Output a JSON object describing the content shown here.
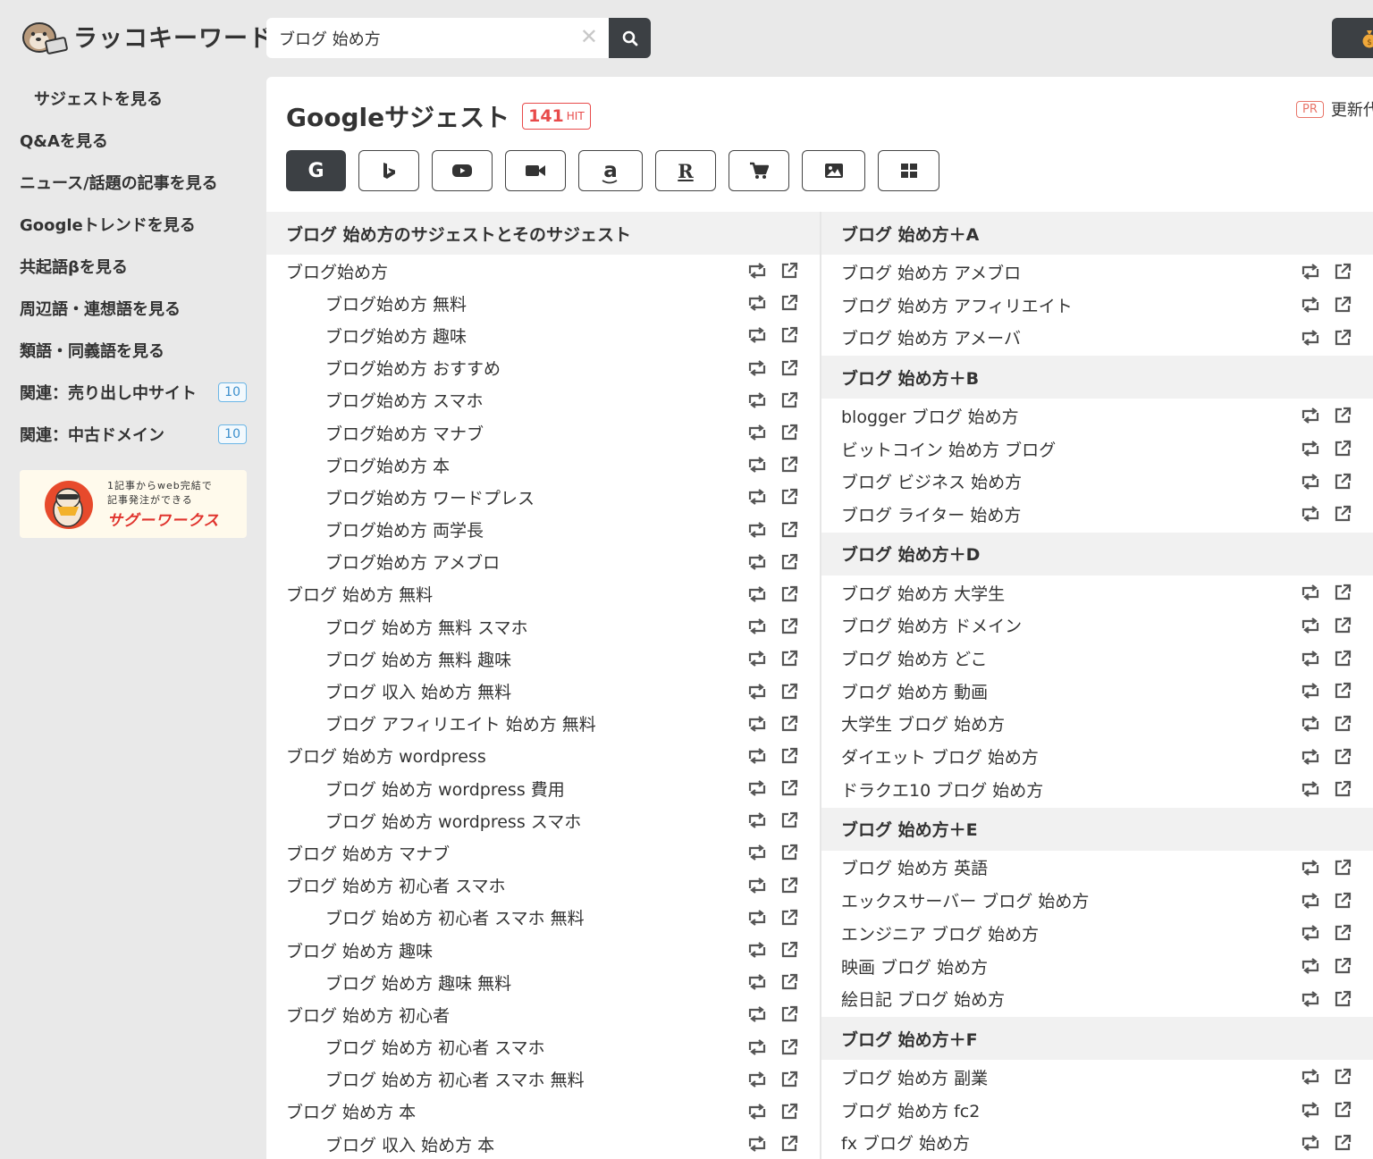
{
  "header": {
    "logo_text": "ラッコキーワード",
    "search_value": "ブログ 始め方",
    "clear_symbol": "✕"
  },
  "sidebar": {
    "items": [
      {
        "label": "サジェストを見る"
      },
      {
        "label": "Q&Aを見る"
      },
      {
        "label": "ニュース/話題の記事を見る"
      },
      {
        "label": "Googleトレンドを見る"
      },
      {
        "label": "共起語βを見る"
      },
      {
        "label": "周辺語・連想語を見る"
      },
      {
        "label": "類語・同義語を見る"
      },
      {
        "label": "関連：売り出し中サイト",
        "count": "10"
      },
      {
        "label": "関連：中古ドメイン",
        "count": "10"
      }
    ],
    "banner": {
      "sub": "1記事からweb完結で\n記事発注ができる",
      "title": "サグーワークス"
    }
  },
  "main": {
    "title": "Googleサジェスト",
    "hit_count": "141",
    "hit_unit": "HIT",
    "pr_badge": "PR",
    "pr_text": "更新代",
    "tabs": [
      {
        "name": "google",
        "icon": "google-icon",
        "label": "G"
      },
      {
        "name": "bing",
        "icon": "bing-icon",
        "label": "b"
      },
      {
        "name": "youtube",
        "icon": "youtube-icon",
        "label": ""
      },
      {
        "name": "video",
        "icon": "video-camera-icon",
        "label": ""
      },
      {
        "name": "amazon",
        "icon": "amazon-icon",
        "label": "a"
      },
      {
        "name": "rakuten",
        "icon": "rakuten-icon",
        "label": "R"
      },
      {
        "name": "shopping",
        "icon": "cart-icon",
        "label": ""
      },
      {
        "name": "image",
        "icon": "image-icon",
        "label": ""
      },
      {
        "name": "apps",
        "icon": "grid-icon",
        "label": ""
      }
    ],
    "left_section": {
      "title": "ブログ 始め方のサジェストとそのサジェスト",
      "rows": [
        {
          "text": "ブログ始め方",
          "indent": 0
        },
        {
          "text": "ブログ始め方 無料",
          "indent": 1
        },
        {
          "text": "ブログ始め方 趣味",
          "indent": 1
        },
        {
          "text": "ブログ始め方 おすすめ",
          "indent": 1
        },
        {
          "text": "ブログ始め方 スマホ",
          "indent": 1
        },
        {
          "text": "ブログ始め方 マナブ",
          "indent": 1
        },
        {
          "text": "ブログ始め方 本",
          "indent": 1
        },
        {
          "text": "ブログ始め方 ワードプレス",
          "indent": 1
        },
        {
          "text": "ブログ始め方 両学長",
          "indent": 1
        },
        {
          "text": "ブログ始め方 アメブロ",
          "indent": 1
        },
        {
          "text": "ブログ 始め方 無料",
          "indent": 0
        },
        {
          "text": "ブログ 始め方 無料 スマホ",
          "indent": 1
        },
        {
          "text": "ブログ 始め方 無料 趣味",
          "indent": 1
        },
        {
          "text": "ブログ 収入 始め方 無料",
          "indent": 1
        },
        {
          "text": "ブログ アフィリエイト 始め方 無料",
          "indent": 1
        },
        {
          "text": "ブログ 始め方 wordpress",
          "indent": 0
        },
        {
          "text": "ブログ 始め方 wordpress 費用",
          "indent": 1
        },
        {
          "text": "ブログ 始め方 wordpress スマホ",
          "indent": 1
        },
        {
          "text": "ブログ 始め方 マナブ",
          "indent": 0
        },
        {
          "text": "ブログ 始め方 初心者 スマホ",
          "indent": 0
        },
        {
          "text": "ブログ 始め方 初心者 スマホ 無料",
          "indent": 1
        },
        {
          "text": "ブログ 始め方 趣味",
          "indent": 0
        },
        {
          "text": "ブログ 始め方 趣味 無料",
          "indent": 1
        },
        {
          "text": "ブログ 始め方 初心者",
          "indent": 0
        },
        {
          "text": "ブログ 始め方 初心者 スマホ",
          "indent": 1
        },
        {
          "text": "ブログ 始め方 初心者 スマホ 無料",
          "indent": 1
        },
        {
          "text": "ブログ 始め方 本",
          "indent": 0
        },
        {
          "text": "ブログ 収入 始め方 本",
          "indent": 1
        }
      ]
    },
    "right_sections": [
      {
        "title": "ブログ 始め方＋A",
        "rows": [
          "ブログ 始め方 アメブロ",
          "ブログ 始め方 アフィリエイト",
          "ブログ 始め方 アメーバ"
        ]
      },
      {
        "title": "ブログ 始め方＋B",
        "rows": [
          "blogger ブログ 始め方",
          "ビットコイン 始め方 ブログ",
          "ブログ ビジネス 始め方",
          "ブログ ライター 始め方"
        ]
      },
      {
        "title": "ブログ 始め方＋D",
        "rows": [
          "ブログ 始め方 大学生",
          "ブログ 始め方 ドメイン",
          "ブログ 始め方 どこ",
          "ブログ 始め方 動画",
          "大学生 ブログ 始め方",
          "ダイエット ブログ 始め方",
          "ドラクエ10 ブログ 始め方"
        ]
      },
      {
        "title": "ブログ 始め方＋E",
        "rows": [
          "ブログ 始め方 英語",
          "エックスサーバー ブログ 始め方",
          "エンジニア ブログ 始め方",
          "映画 ブログ 始め方",
          "絵日記 ブログ 始め方"
        ]
      },
      {
        "title": "ブログ 始め方＋F",
        "rows": [
          "ブログ 始め方 副業",
          "ブログ 始め方 fc2",
          "fx ブログ 始め方"
        ]
      }
    ]
  },
  "colors": {
    "background": "#e9e9e9",
    "dark_button": "#3c4044",
    "hit_red": "#e84a4a",
    "badge_blue": "#3b8fcc",
    "section_header_bg": "#f1f1f1"
  }
}
